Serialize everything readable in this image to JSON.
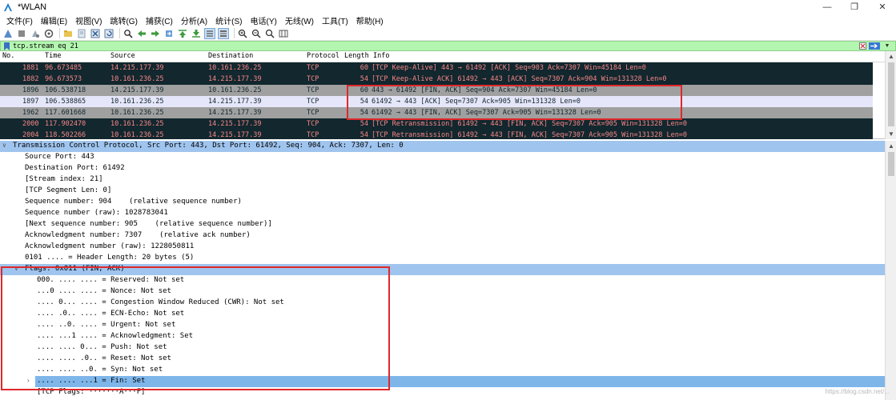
{
  "window": {
    "title": "*WLAN",
    "minimize_glyph": "—",
    "maximize_glyph": "❐",
    "close_glyph": "✕"
  },
  "menu": [
    "文件(F)",
    "编辑(E)",
    "视图(V)",
    "跳转(G)",
    "捕获(C)",
    "分析(A)",
    "统计(S)",
    "电话(Y)",
    "无线(W)",
    "工具(T)",
    "帮助(H)"
  ],
  "filter": {
    "value": "tcp.stream eq 21"
  },
  "packet_list": {
    "columns": [
      "No.",
      "Time",
      "Source",
      "Destination",
      "Protocol",
      "Length",
      "Info"
    ],
    "rows": [
      {
        "no": "1881",
        "time": "96.673485",
        "src": "14.215.177.39",
        "dst": "10.161.236.25",
        "proto": "TCP",
        "len": "60",
        "info": "[TCP Keep-Alive] 443 → 61492 [ACK] Seq=903 Ack=7307 Win=45184 Len=0",
        "style": "dark"
      },
      {
        "no": "1882",
        "time": "96.673573",
        "src": "10.161.236.25",
        "dst": "14.215.177.39",
        "proto": "TCP",
        "len": "54",
        "info": "[TCP Keep-Alive ACK] 61492 → 443 [ACK] Seq=7307 Ack=904 Win=131328 Len=0",
        "style": "dark"
      },
      {
        "no": "1896",
        "time": "106.538718",
        "src": "14.215.177.39",
        "dst": "10.161.236.25",
        "proto": "TCP",
        "len": "60",
        "info": "443 → 61492 [FIN, ACK] Seq=904 Ack=7307 Win=45184 Len=0",
        "style": "gray"
      },
      {
        "no": "1897",
        "time": "106.538865",
        "src": "10.161.236.25",
        "dst": "14.215.177.39",
        "proto": "TCP",
        "len": "54",
        "info": "61492 → 443 [ACK] Seq=7307 Ack=905 Win=131328 Len=0",
        "style": "sel"
      },
      {
        "no": "1962",
        "time": "117.601668",
        "src": "10.161.236.25",
        "dst": "14.215.177.39",
        "proto": "TCP",
        "len": "54",
        "info": "61492 → 443 [FIN, ACK] Seq=7307 Ack=905 Win=131328 Len=0",
        "style": "gray"
      },
      {
        "no": "2000",
        "time": "117.902470",
        "src": "10.161.236.25",
        "dst": "14.215.177.39",
        "proto": "TCP",
        "len": "54",
        "info": "[TCP Retransmission] 61492 → 443 [FIN, ACK] Seq=7307 Ack=905 Win=131328 Len=0",
        "style": "dark"
      },
      {
        "no": "2004",
        "time": "118.502266",
        "src": "10.161.236.25",
        "dst": "14.215.177.39",
        "proto": "TCP",
        "len": "54",
        "info": "[TCP Retransmission] 61492 → 443 [FIN, ACK] Seq=7307 Ack=905 Win=131328 Len=0",
        "style": "dark"
      }
    ]
  },
  "details": {
    "header": "Transmission Control Protocol, Src Port: 443, Dst Port: 61492, Seq: 904, Ack: 7307, Len: 0",
    "fields": [
      "Source Port: 443",
      "Destination Port: 61492",
      "[Stream index: 21]",
      "[TCP Segment Len: 0]",
      "Sequence number: 904    (relative sequence number)",
      "Sequence number (raw): 1028783041",
      "[Next sequence number: 905    (relative sequence number)]",
      "Acknowledgment number: 7307    (relative ack number)",
      "Acknowledgment number (raw): 1228050811",
      "0101 .... = Header Length: 20 bytes (5)"
    ],
    "flags_header": "Flags: 0x011 (FIN, ACK)",
    "flags": [
      "000. .... .... = Reserved: Not set",
      "...0 .... .... = Nonce: Not set",
      ".... 0... .... = Congestion Window Reduced (CWR): Not set",
      ".... .0.. .... = ECN-Echo: Not set",
      ".... ..0. .... = Urgent: Not set",
      ".... ...1 .... = Acknowledgment: Set",
      ".... .... 0... = Push: Not set",
      ".... .... .0.. = Reset: Not set",
      ".... .... ..0. = Syn: Not set",
      ".... .... ...1 = Fin: Set"
    ],
    "tcp_flags_line": "[TCP Flags: ·······A···F]"
  },
  "colors": {
    "filter_ok": "#b3f6b0",
    "row_dark_bg": "#12272e",
    "row_dark_fg": "#f78787",
    "row_gray_bg": "#a0a0a0",
    "row_selected_bg": "#e6e6fa",
    "detail_highlight": "#9fc4ee",
    "annotation": "#e0282b"
  },
  "watermark": "https://blog.csdn.net/..."
}
